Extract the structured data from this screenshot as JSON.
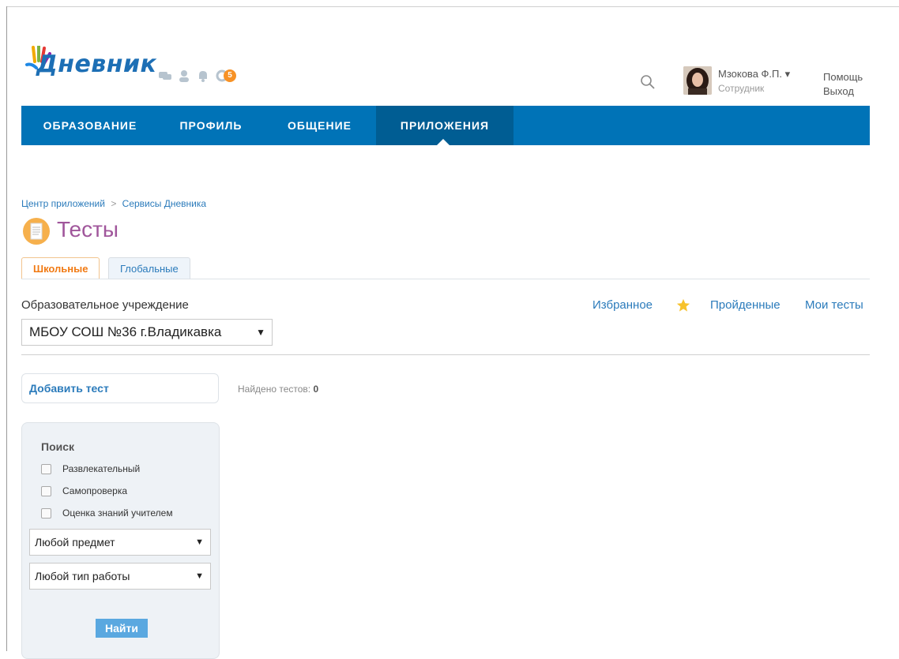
{
  "brand": {
    "logo_text": "Дневник",
    "notification_count": "5"
  },
  "user": {
    "name": "Мзокова Ф.П.",
    "role": "Сотрудник",
    "help_label": "Помощь",
    "logout_label": "Выход"
  },
  "nav": {
    "items": [
      "ОБРАЗОВАНИЕ",
      "ПРОФИЛЬ",
      "ОБЩЕНИЕ",
      "ПРИЛОЖЕНИЯ"
    ],
    "active": "ПРИЛОЖЕНИЯ"
  },
  "breadcrumb": {
    "items": [
      "Центр приложений",
      "Сервисы Дневника"
    ],
    "separator": ">"
  },
  "page": {
    "title": "Тесты"
  },
  "tabs": {
    "items": [
      "Школьные",
      "Глобальные"
    ],
    "active": "Школьные"
  },
  "filters": {
    "org_label": "Образовательное учреждение",
    "org_selected": "МБОУ СОШ №36 г.Владикавка"
  },
  "right_links": {
    "favorites": "Избранное",
    "completed": "Пройденные",
    "my_tests": "Мои тесты"
  },
  "actions": {
    "add_test": "Добавить тест",
    "found_label": "Найдено тестов:",
    "found_count": "0"
  },
  "search": {
    "title": "Поиск",
    "checkboxes": [
      "Развлекательный",
      "Самопроверка",
      "Оценка знаний учителем"
    ],
    "subject_selected": "Любой предмет",
    "work_type_selected": "Любой тип работы",
    "find_button": "Найти"
  },
  "colors": {
    "nav_bg": "#0073b7",
    "nav_active": "#005d93",
    "link": "#2b7bbb",
    "title": "#a0569b",
    "tab_active": "#f17a13",
    "badge": "#f79226",
    "button": "#5aa8e0"
  },
  "icons": {
    "header": [
      "chat-icon",
      "user-icon",
      "bell-icon",
      "refresh-icon"
    ],
    "search": "search-icon",
    "favorites": "star-icon",
    "page": "document-icon"
  }
}
